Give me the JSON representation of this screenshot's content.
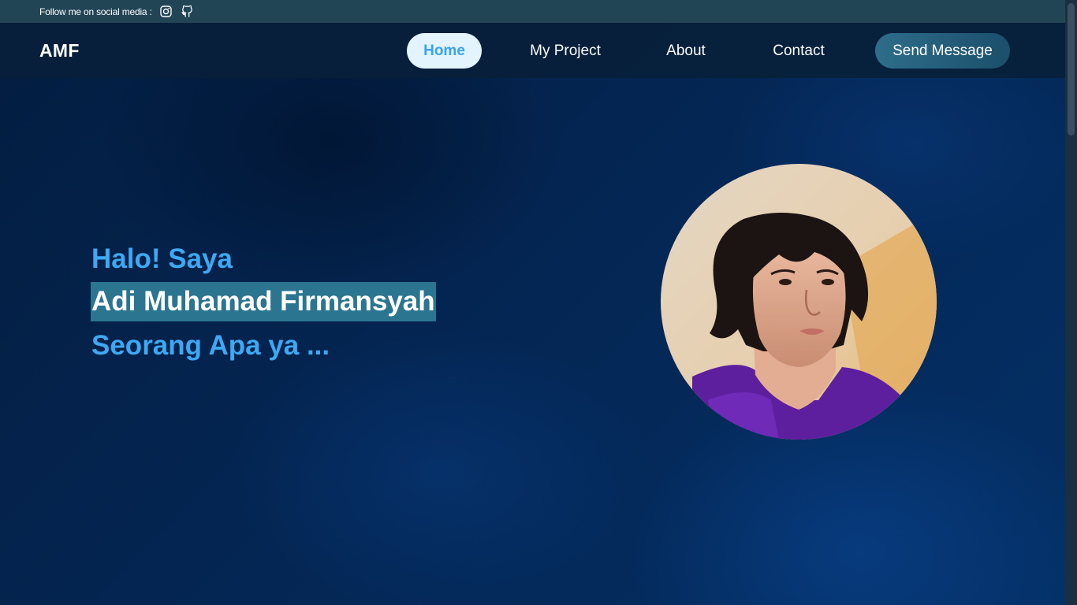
{
  "social_bar": {
    "label": "Follow me on social media :",
    "icons": [
      "instagram-icon",
      "github-icon"
    ]
  },
  "navbar": {
    "brand": "AMF",
    "items": [
      {
        "label": "Home",
        "active": true
      },
      {
        "label": "My Project",
        "active": false
      },
      {
        "label": "About",
        "active": false
      },
      {
        "label": "Contact",
        "active": false
      }
    ],
    "cta_label": "Send Message"
  },
  "hero": {
    "greeting": "Halo! Saya",
    "name": "Adi Muhamad Firmansyah",
    "role": "Seorang Apa ya ..."
  },
  "colors": {
    "accent": "#3ea8f2",
    "background": "#04224a",
    "active_nav_bg": "#e3f4ff",
    "name_highlight": "#2b7590",
    "social_bar_bg": "#224556"
  }
}
